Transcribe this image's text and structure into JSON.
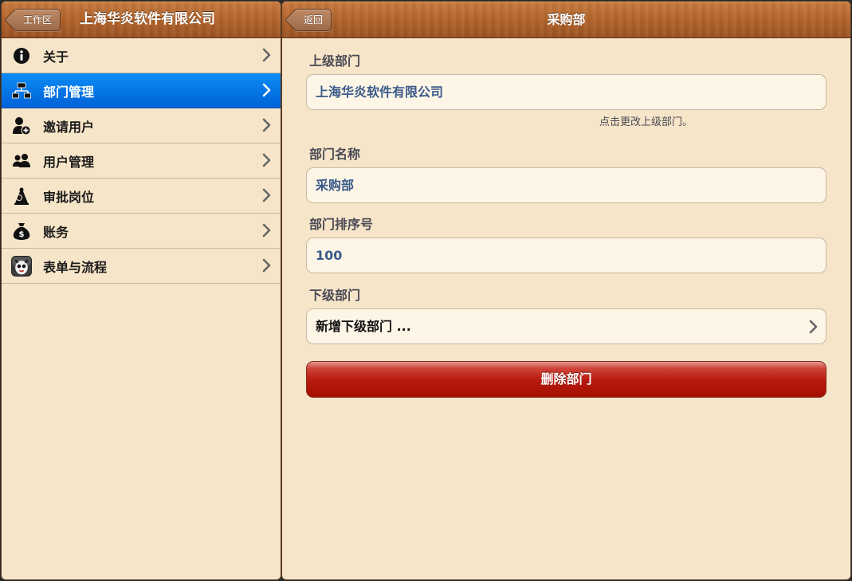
{
  "left_nav": {
    "back_label": "工作区",
    "title": "上海华炎软件有限公司"
  },
  "sidebar": {
    "items": [
      {
        "label": "关于",
        "icon": "info-icon",
        "selected": false
      },
      {
        "label": "部门管理",
        "icon": "org-chart-icon",
        "selected": true
      },
      {
        "label": "邀请用户",
        "icon": "add-user-icon",
        "selected": false
      },
      {
        "label": "用户管理",
        "icon": "users-icon",
        "selected": false
      },
      {
        "label": "审批岗位",
        "icon": "approval-icon",
        "selected": false
      },
      {
        "label": "账务",
        "icon": "money-bag-icon",
        "selected": false
      },
      {
        "label": "表单与流程",
        "icon": "app-icon",
        "selected": false
      }
    ]
  },
  "right_nav": {
    "back_label": "返回",
    "title": "采购部"
  },
  "form": {
    "parent_label": "上级部门",
    "parent_value": "上海华炎软件有限公司",
    "parent_hint": "点击更改上级部门。",
    "name_label": "部门名称",
    "name_value": "采购部",
    "order_label": "部门排序号",
    "order_value": "100",
    "children_label": "下级部门",
    "add_child": "新增下级部门 ...",
    "delete_button": "删除部门"
  },
  "colors": {
    "background": "#f6e5c8",
    "selected": "#0a7ff0",
    "delete": "#b81a10",
    "wood": "#b4652c"
  }
}
